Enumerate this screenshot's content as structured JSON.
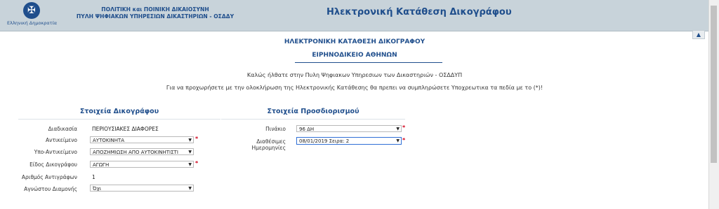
{
  "header": {
    "logo_text": "Ελληνική Δημοκρατία",
    "org_line1": "ΠΟΛΙΤΙΚΗ και ΠΟΙΝΙΚΗ ΔΙΚΑΙΟΣΥΝΗ",
    "org_line2": "ΠΥΛΗ ΨΗΦΙΑΚΩΝ ΥΠΗΡΕΣΙΩΝ ΔΙΚΑΣΤΗΡΙΩΝ - ΟΣΔΔΥ",
    "app_title": "Ηλεκτρονική Κατάθεση Δικογράφου"
  },
  "page": {
    "title": "ΗΛΕΚΤΡΟΝΙΚΗ ΚΑΤΑΘΕΣΗ ΔΙΚΟΓΡΑΦΟΥ",
    "court": "ΕΙΡΗΝΟΔΙΚΕΙΟ ΑΘΗΝΩΝ",
    "welcome": "Καλώς ήλθατε στην Πυλη Ψηφιακων Υπηρεσιων των Δικαστηριών - ΟΣΔΔΥΠ",
    "instructions": "Για να προχωρήσετε με την ολοκλήρωση της Ηλεκτρονικής Κατάθεσης θα πρεπει να συμπληρώσετε Υποχρεωτικα τα πεδία με το (*)!"
  },
  "doc_section": {
    "title": "Στοιχεία Δικογράφου",
    "fields": [
      {
        "label": "Διαδικασία",
        "value": "ΠΕΡΙΟΥΣΙΑΚΕΣ ΔΙΑΦΟΡΕΣ"
      },
      {
        "label": "Αντικείμενο",
        "value": "ΑΥΤΟΚΙΝΗΤΑ",
        "required": "*"
      },
      {
        "label": "Υπο-Αντικείμενο",
        "value": "ΑΠΟΖΗΜΙΩΣΗ ΑΠΟ ΑΥΤΟΚΙΝΗΤΙΣΤΙ"
      },
      {
        "label": "Είδος Δικογράφου",
        "value": "ΑΓΩΓΗ",
        "required": "*"
      },
      {
        "label": "Αριθμός Αντιγράφων",
        "value": "1"
      },
      {
        "label": "Αγνώστου Διαμονής",
        "value": "Όχι"
      }
    ]
  },
  "schedule_section": {
    "title": "Στοιχεία Προσδιορισμού",
    "fields": [
      {
        "label": "Πινάκιο",
        "value": "96 ΔΗ",
        "required": "*"
      },
      {
        "label": "Διαθέσιμες Ημερομηνίες",
        "value": "08/01/2019 Σειρα: 2",
        "required": "*"
      }
    ]
  },
  "icons": {
    "dropdown": "▼",
    "scroll_top": "▲",
    "emblem": "✠"
  }
}
